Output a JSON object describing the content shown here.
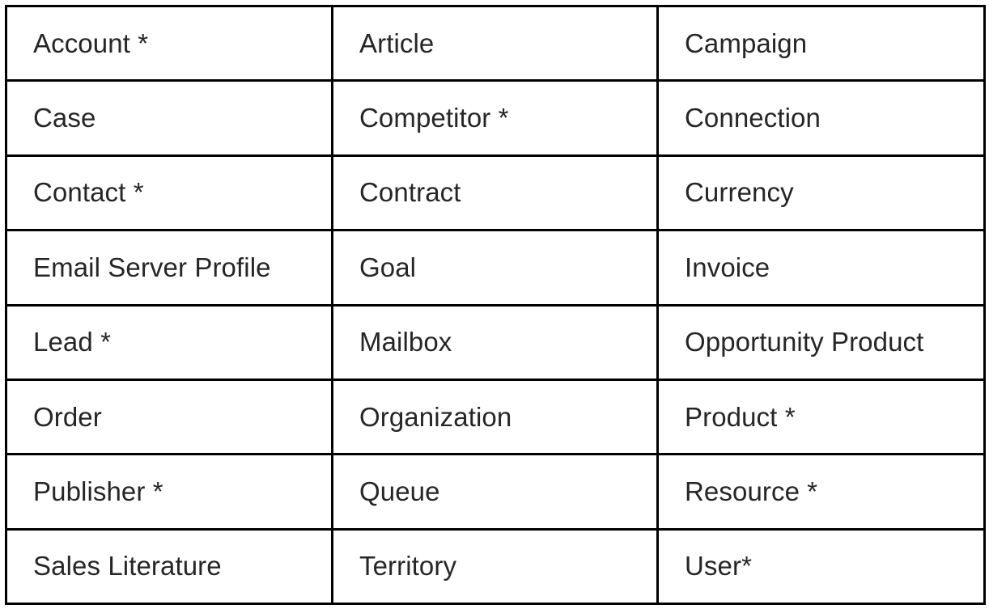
{
  "table": {
    "columns": 3,
    "rows": 8,
    "border_color": "#000000",
    "text_color": "#262626",
    "background_color": "#ffffff",
    "required_marker": "*",
    "cells": [
      [
        "Account *",
        "Article",
        "Campaign"
      ],
      [
        "Case",
        "Competitor *",
        "Connection"
      ],
      [
        "Contact *",
        "Contract",
        "Currency"
      ],
      [
        "Email Server Profile",
        "Goal",
        "Invoice"
      ],
      [
        "Lead *",
        "Mailbox",
        "Opportunity Product"
      ],
      [
        "Order",
        "Organization",
        "Product *"
      ],
      [
        "Publisher *",
        "Queue",
        "Resource *"
      ],
      [
        "Sales Literature",
        "Territory",
        "User*"
      ]
    ]
  }
}
